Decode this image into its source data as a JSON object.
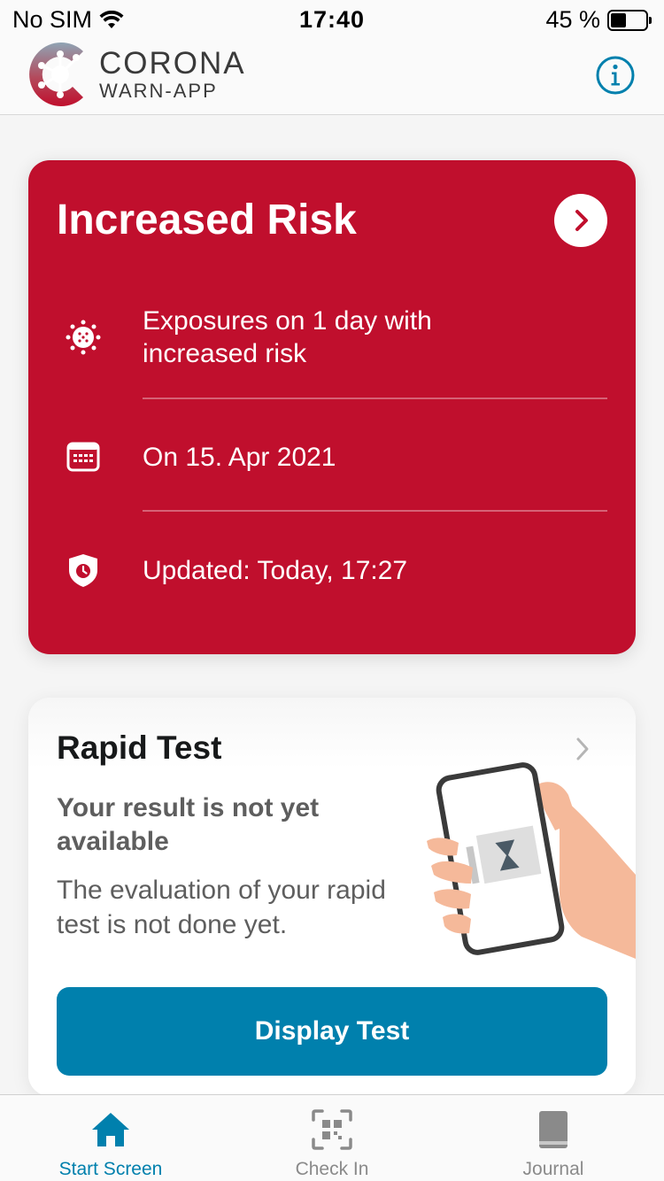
{
  "status_bar": {
    "carrier": "No SIM",
    "time": "17:40",
    "battery": "45 %",
    "battery_level": 0.45
  },
  "header": {
    "logo_title": "CORONA",
    "logo_subtitle": "WARN-APP",
    "info_icon": "info-icon"
  },
  "risk_card": {
    "title": "Increased Risk",
    "background_color": "#c00f2d",
    "rows": [
      {
        "icon": "virus-icon",
        "text": "Exposures on 1 day with increased risk"
      },
      {
        "icon": "calendar-icon",
        "text": "On 15. Apr 2021"
      },
      {
        "icon": "shield-clock-icon",
        "text": "Updated: Today, 17:27"
      }
    ]
  },
  "test_card": {
    "title": "Rapid Test",
    "subtitle": "Your result is not yet available",
    "description": "The evaluation of your rapid test is not done yet.",
    "button_label": "Display Test",
    "button_color": "#0080ad"
  },
  "tab_bar": {
    "active_color": "#0080ad",
    "tabs": [
      {
        "label": "Start Screen",
        "icon": "home-icon",
        "active": true
      },
      {
        "label": "Check In",
        "icon": "qr-scan-icon",
        "active": false
      },
      {
        "label": "Journal",
        "icon": "book-icon",
        "active": false
      }
    ]
  }
}
